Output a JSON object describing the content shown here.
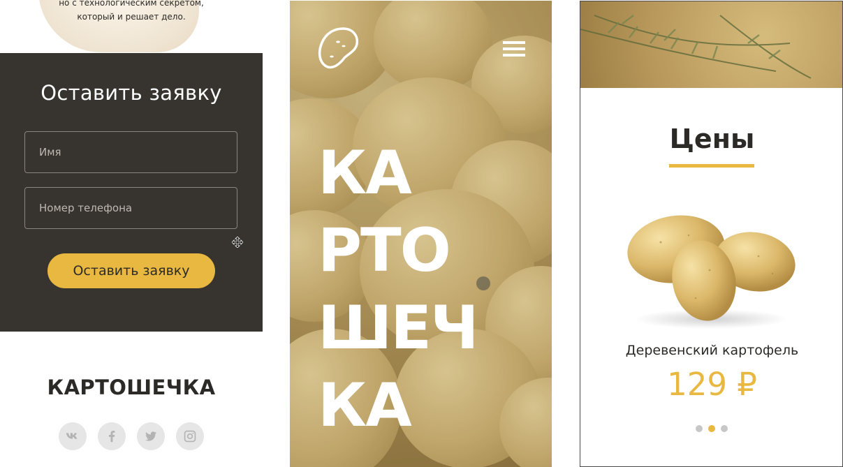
{
  "left": {
    "intro_lines": [
      "но с технологическим секретом,",
      "который и решает дело."
    ],
    "form": {
      "title": "Оставить заявку",
      "name_placeholder": "Имя",
      "phone_placeholder": "Номер телефона",
      "submit_label": "Оставить заявку"
    },
    "footer_brand": "КАРТОШЕЧКА",
    "socials": [
      "vk-icon",
      "facebook-icon",
      "twitter-icon",
      "instagram-icon"
    ]
  },
  "hero": {
    "title_lines": [
      "КА",
      "РТО",
      "ШЕЧ",
      "КА"
    ],
    "menu_icon": "hamburger-menu-icon",
    "logo_icon": "potato-logo-icon"
  },
  "prices": {
    "title": "Цены",
    "product_name": "Деревенский картофель",
    "product_price": "129 ₽",
    "carousel_active_index": 1,
    "carousel_count": 3
  },
  "colors": {
    "accent": "#e9b841",
    "dark_panel": "#37332e",
    "text_dark": "#2b2a27",
    "social_bg": "#e6e6e6"
  }
}
